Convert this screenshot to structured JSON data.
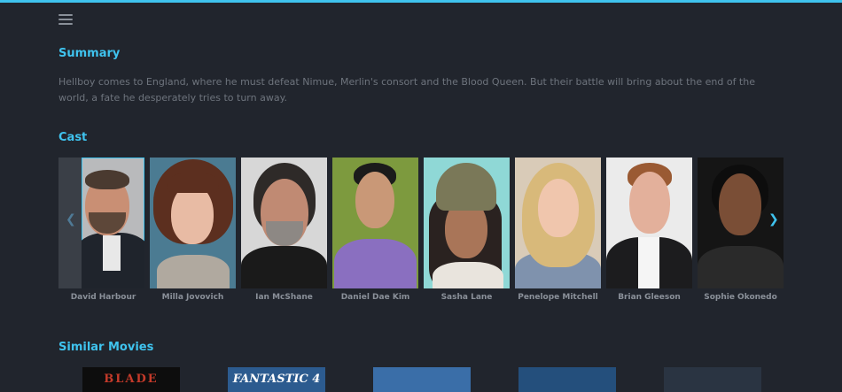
{
  "header": {
    "menu_icon": "hamburger-menu-icon"
  },
  "summary": {
    "title": "Summary",
    "text": "Hellboy comes to England, where he must defeat Nimue, Merlin's consort and the Blood Queen. But their battle will bring about the end of the world, a fate he desperately tries to turn away."
  },
  "cast": {
    "title": "Cast",
    "members": [
      {
        "name": "David Harbour"
      },
      {
        "name": "Milla Jovovich"
      },
      {
        "name": "Ian McShane"
      },
      {
        "name": "Daniel Dae Kim"
      },
      {
        "name": "Sasha Lane"
      },
      {
        "name": "Penelope Mitchell"
      },
      {
        "name": "Brian Gleeson"
      },
      {
        "name": "Sophie Okonedo"
      }
    ],
    "prev_icon": "chevron-left-icon",
    "next_icon": "chevron-right-icon"
  },
  "similar": {
    "title": "Similar Movies",
    "posters": [
      {
        "label": "BLADE"
      },
      {
        "label": "FANTASTIC 4"
      },
      {
        "label": ""
      },
      {
        "label": ""
      },
      {
        "label": ""
      }
    ]
  },
  "colors": {
    "accent": "#3fc3ee",
    "background": "#21252d",
    "muted_text": "#6e747d"
  }
}
